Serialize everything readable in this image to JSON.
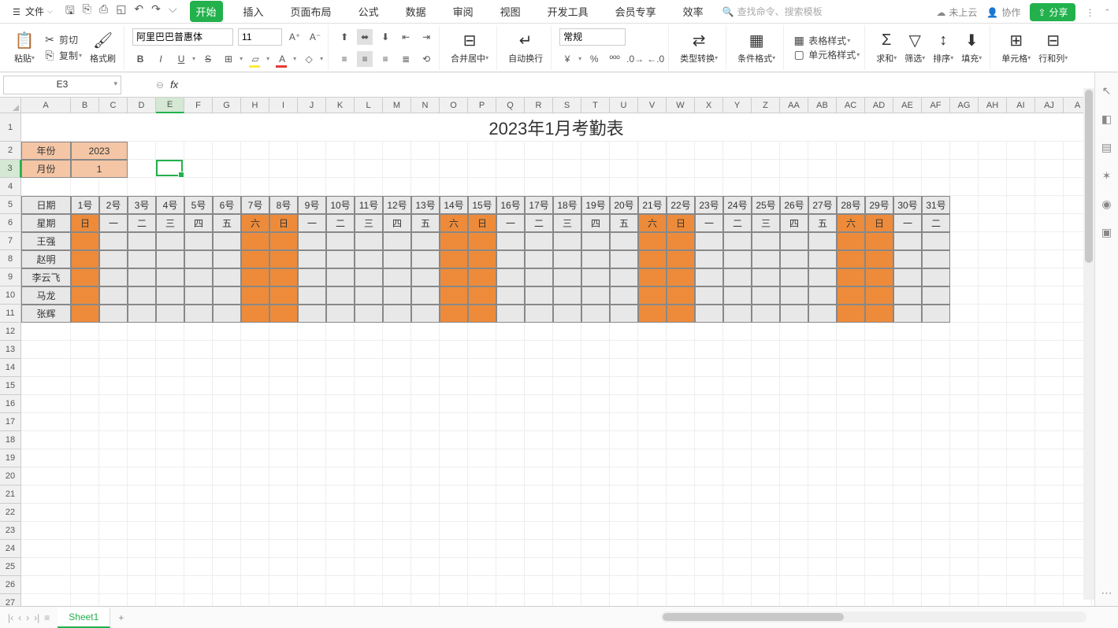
{
  "topbar": {
    "file_label": "文件",
    "tabs": [
      "开始",
      "插入",
      "页面布局",
      "公式",
      "数据",
      "审阅",
      "视图",
      "开发工具",
      "会员专享",
      "效率"
    ],
    "active_tab": 0,
    "search_placeholder": "查找命令、搜索模板",
    "cloud_status": "未上云",
    "collab_label": "协作",
    "share_label": "分享"
  },
  "ribbon": {
    "paste_label": "粘贴",
    "cut_label": "剪切",
    "copy_label": "复制",
    "format_painter_label": "格式刷",
    "font_name": "阿里巴巴普惠体",
    "font_size": "11",
    "merge_label": "合并居中",
    "wrap_label": "自动换行",
    "number_format": "常规",
    "type_convert_label": "类型转换",
    "conditional_label": "条件格式",
    "table_style_label": "表格样式",
    "cell_style_label": "单元格样式",
    "sum_label": "求和",
    "filter_label": "筛选",
    "sort_label": "排序",
    "fill_label": "填充",
    "cell_label": "单元格",
    "rowcol_label": "行和列"
  },
  "formula_bar": {
    "cell_ref": "E3",
    "formula": ""
  },
  "columns": [
    "A",
    "B",
    "C",
    "D",
    "E",
    "F",
    "G",
    "H",
    "I",
    "J",
    "K",
    "L",
    "M",
    "N",
    "O",
    "P",
    "Q",
    "R",
    "S",
    "T",
    "U",
    "V",
    "W",
    "X",
    "Y",
    "Z",
    "AA",
    "AB",
    "AC",
    "AD",
    "AE",
    "AF",
    "AG",
    "AH",
    "AI",
    "AJ",
    "A"
  ],
  "col_A_width": 63,
  "narrow_width": 36,
  "row_heights": {
    "1": 36,
    "default": 23
  },
  "selected_col": "E",
  "selected_row": 3,
  "sheet": {
    "title": "2023年1月考勤表",
    "year_label": "年份",
    "year_value": "2023",
    "month_label": "月份",
    "month_value": "1",
    "date_header": "日期",
    "weekday_header": "星期",
    "dates": [
      "1号",
      "2号",
      "3号",
      "4号",
      "5号",
      "6号",
      "7号",
      "8号",
      "9号",
      "10号",
      "11号",
      "12号",
      "13号",
      "14号",
      "15号",
      "16号",
      "17号",
      "18号",
      "19号",
      "20号",
      "21号",
      "22号",
      "23号",
      "24号",
      "25号",
      "26号",
      "27号",
      "28号",
      "29号",
      "30号",
      "31号"
    ],
    "weekdays": [
      "日",
      "一",
      "二",
      "三",
      "四",
      "五",
      "六",
      "日",
      "一",
      "二",
      "三",
      "四",
      "五",
      "六",
      "日",
      "一",
      "二",
      "三",
      "四",
      "五",
      "六",
      "日",
      "一",
      "二",
      "三",
      "四",
      "五",
      "六",
      "日",
      "一",
      "二"
    ],
    "weekend_flags": [
      true,
      false,
      false,
      false,
      false,
      false,
      true,
      true,
      false,
      false,
      false,
      false,
      false,
      true,
      true,
      false,
      false,
      false,
      false,
      false,
      true,
      true,
      false,
      false,
      false,
      false,
      false,
      true,
      true,
      false,
      false
    ],
    "employees": [
      "王强",
      "赵明",
      "李云飞",
      "马龙",
      "张辉"
    ]
  },
  "sheet_tabs": {
    "active": "Sheet1",
    "tabs": [
      "Sheet1"
    ]
  }
}
